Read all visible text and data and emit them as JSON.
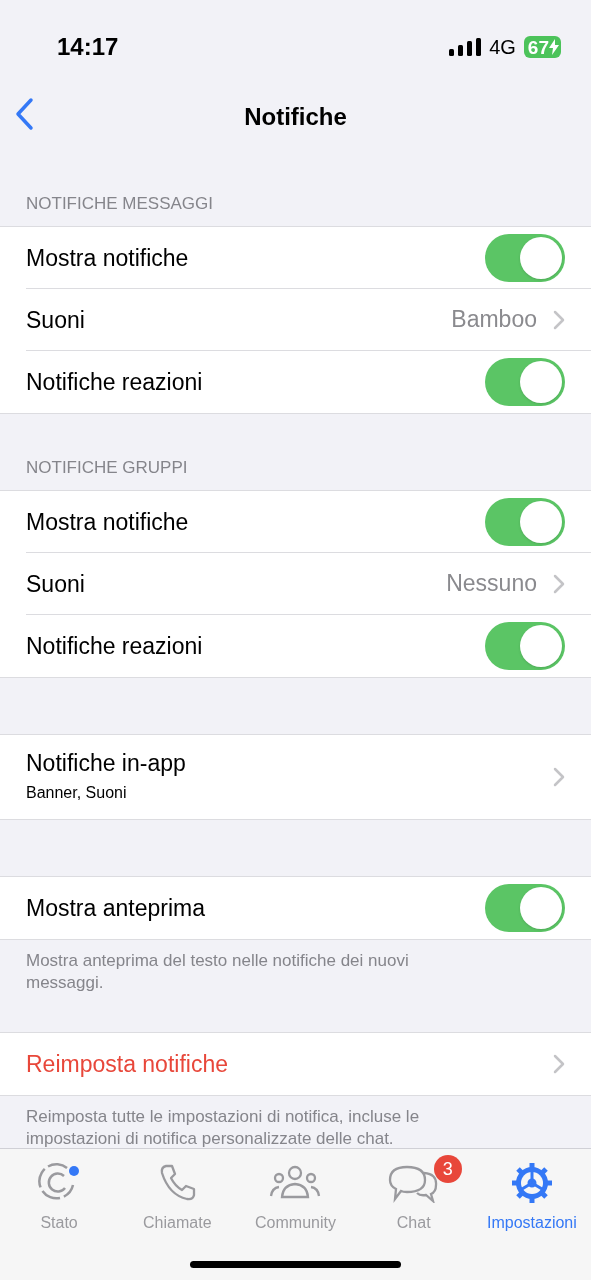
{
  "status_bar": {
    "time": "14:17",
    "network": "4G",
    "battery": "67",
    "charging": true
  },
  "nav": {
    "title": "Notifiche"
  },
  "sections": [
    {
      "header": "NOTIFICHE MESSAGGI",
      "rows": [
        {
          "kind": "toggle",
          "label": "Mostra notifiche",
          "on": true
        },
        {
          "kind": "value",
          "label": "Suoni",
          "value": "Bamboo"
        },
        {
          "kind": "toggle",
          "label": "Notifiche reazioni",
          "on": true
        }
      ]
    },
    {
      "header": "NOTIFICHE GRUPPI",
      "rows": [
        {
          "kind": "toggle",
          "label": "Mostra notifiche",
          "on": true
        },
        {
          "kind": "value",
          "label": "Suoni",
          "value": "Nessuno"
        },
        {
          "kind": "toggle",
          "label": "Notifiche reazioni",
          "on": true
        }
      ]
    },
    {
      "rows": [
        {
          "kind": "subtitle",
          "label": "Notifiche in-app",
          "subtitle": "Banner, Suoni"
        }
      ]
    },
    {
      "rows": [
        {
          "kind": "toggle",
          "label": "Mostra anteprima",
          "on": true
        }
      ],
      "footer": "Mostra anteprima del testo nelle notifiche dei nuovi messaggi."
    },
    {
      "rows": [
        {
          "kind": "action",
          "label": "Reimposta notifiche"
        }
      ],
      "footer": "Reimposta tutte le impostazioni di notifica, incluse le impostazioni di notifica personalizzate delle chat."
    }
  ],
  "tabs": [
    {
      "kind": "status",
      "label": "Stato",
      "selected": false,
      "dot": true
    },
    {
      "kind": "calls",
      "label": "Chiamate",
      "selected": false
    },
    {
      "kind": "community",
      "label": "Community",
      "selected": false
    },
    {
      "kind": "chat",
      "label": "Chat",
      "selected": false,
      "badge": "3"
    },
    {
      "kind": "settings",
      "label": "Impostazioni",
      "selected": true
    }
  ]
}
